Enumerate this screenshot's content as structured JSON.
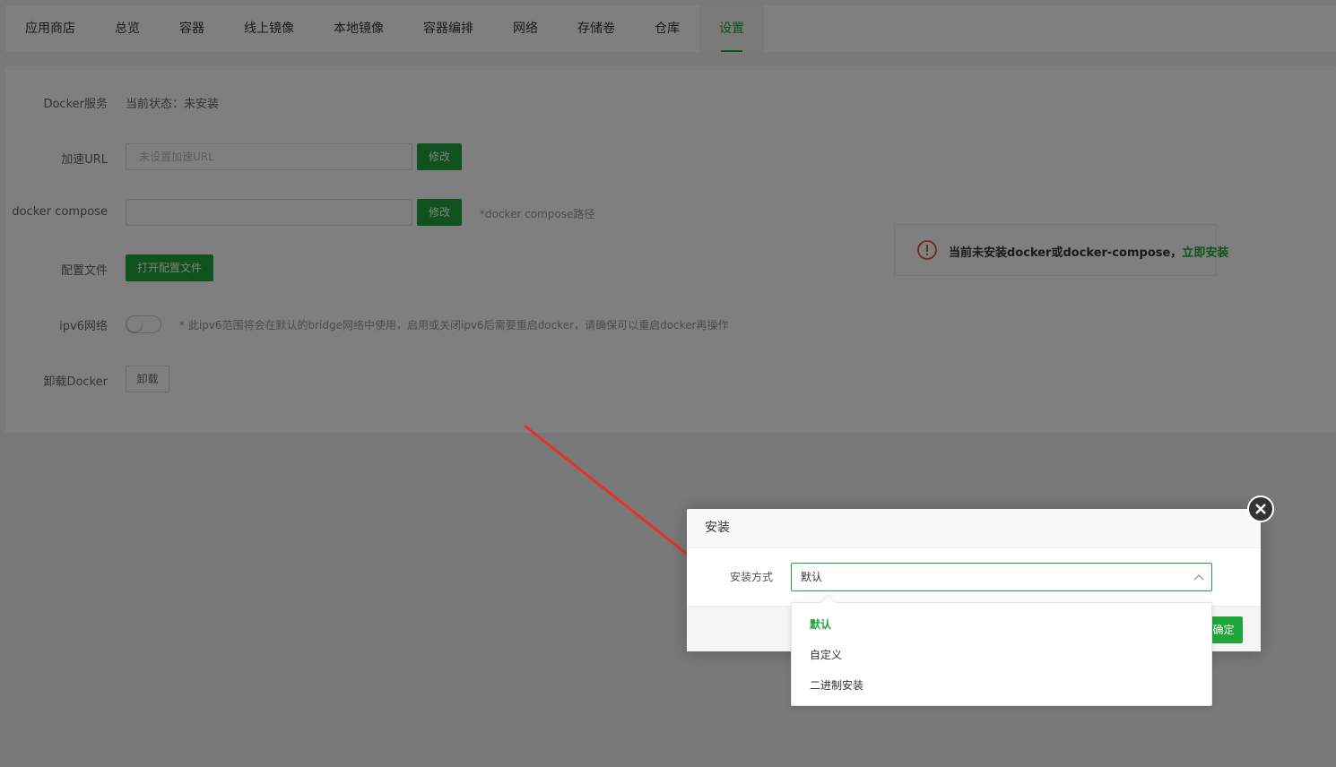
{
  "tabs": [
    {
      "label": "应用商店"
    },
    {
      "label": "总览"
    },
    {
      "label": "容器"
    },
    {
      "label": "线上镜像"
    },
    {
      "label": "本地镜像"
    },
    {
      "label": "容器编排"
    },
    {
      "label": "网络"
    },
    {
      "label": "存储卷"
    },
    {
      "label": "仓库"
    },
    {
      "label": "设置",
      "active": true
    }
  ],
  "settings": {
    "docker_service": {
      "label": "Docker服务",
      "status": "当前状态：未安装"
    },
    "accel_url": {
      "label": "加速URL",
      "placeholder": "未设置加速URL",
      "button": "修改"
    },
    "compose": {
      "label": "docker compose",
      "value": "",
      "button": "修改",
      "hint": "*docker compose路径"
    },
    "config_file": {
      "label": "配置文件",
      "button": "打开配置文件"
    },
    "ipv6": {
      "label": "ipv6网络",
      "enabled": false,
      "hint": "* 此ipv6范围将会在默认的bridge网络中使用，启用或关闭ipv6后需要重启docker，请确保可以重启docker再操作"
    },
    "uninstall": {
      "label": "卸载Docker",
      "button": "卸载"
    }
  },
  "warning": {
    "text": "当前未安装docker或docker-compose，",
    "link": "立即安装",
    "icon": "exclamation-circle-icon",
    "color": "#e8553b"
  },
  "modal": {
    "title": "安装",
    "field_label": "安装方式",
    "selected": "默认",
    "options": [
      "默认",
      "自定义",
      "二进制安装"
    ],
    "confirm": "确定"
  },
  "colors": {
    "accent": "#20a53a",
    "arrow": "#e8312b"
  }
}
